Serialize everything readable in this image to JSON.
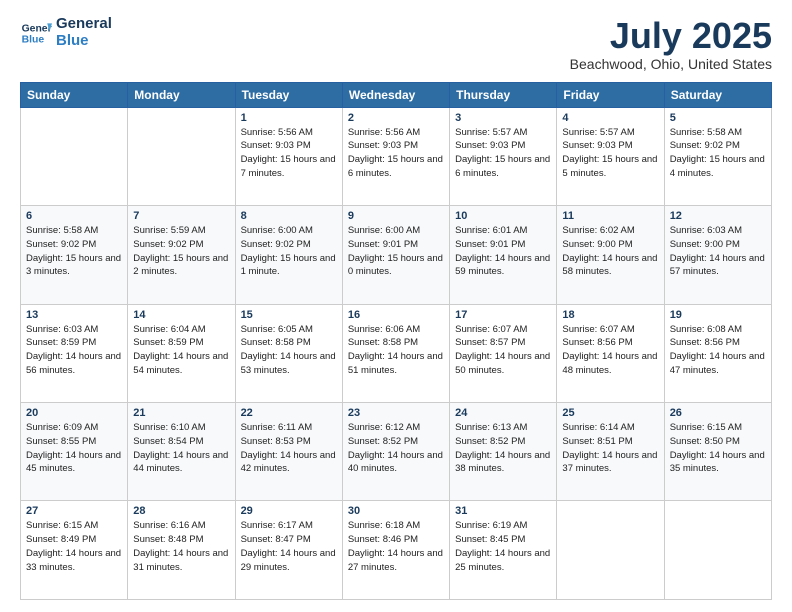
{
  "logo": {
    "line1": "General",
    "line2": "Blue"
  },
  "title": "July 2025",
  "subtitle": "Beachwood, Ohio, United States",
  "days_of_week": [
    "Sunday",
    "Monday",
    "Tuesday",
    "Wednesday",
    "Thursday",
    "Friday",
    "Saturday"
  ],
  "weeks": [
    [
      {
        "day": "",
        "info": ""
      },
      {
        "day": "",
        "info": ""
      },
      {
        "day": "1",
        "info": "Sunrise: 5:56 AM\nSunset: 9:03 PM\nDaylight: 15 hours and 7 minutes."
      },
      {
        "day": "2",
        "info": "Sunrise: 5:56 AM\nSunset: 9:03 PM\nDaylight: 15 hours and 6 minutes."
      },
      {
        "day": "3",
        "info": "Sunrise: 5:57 AM\nSunset: 9:03 PM\nDaylight: 15 hours and 6 minutes."
      },
      {
        "day": "4",
        "info": "Sunrise: 5:57 AM\nSunset: 9:03 PM\nDaylight: 15 hours and 5 minutes."
      },
      {
        "day": "5",
        "info": "Sunrise: 5:58 AM\nSunset: 9:02 PM\nDaylight: 15 hours and 4 minutes."
      }
    ],
    [
      {
        "day": "6",
        "info": "Sunrise: 5:58 AM\nSunset: 9:02 PM\nDaylight: 15 hours and 3 minutes."
      },
      {
        "day": "7",
        "info": "Sunrise: 5:59 AM\nSunset: 9:02 PM\nDaylight: 15 hours and 2 minutes."
      },
      {
        "day": "8",
        "info": "Sunrise: 6:00 AM\nSunset: 9:02 PM\nDaylight: 15 hours and 1 minute."
      },
      {
        "day": "9",
        "info": "Sunrise: 6:00 AM\nSunset: 9:01 PM\nDaylight: 15 hours and 0 minutes."
      },
      {
        "day": "10",
        "info": "Sunrise: 6:01 AM\nSunset: 9:01 PM\nDaylight: 14 hours and 59 minutes."
      },
      {
        "day": "11",
        "info": "Sunrise: 6:02 AM\nSunset: 9:00 PM\nDaylight: 14 hours and 58 minutes."
      },
      {
        "day": "12",
        "info": "Sunrise: 6:03 AM\nSunset: 9:00 PM\nDaylight: 14 hours and 57 minutes."
      }
    ],
    [
      {
        "day": "13",
        "info": "Sunrise: 6:03 AM\nSunset: 8:59 PM\nDaylight: 14 hours and 56 minutes."
      },
      {
        "day": "14",
        "info": "Sunrise: 6:04 AM\nSunset: 8:59 PM\nDaylight: 14 hours and 54 minutes."
      },
      {
        "day": "15",
        "info": "Sunrise: 6:05 AM\nSunset: 8:58 PM\nDaylight: 14 hours and 53 minutes."
      },
      {
        "day": "16",
        "info": "Sunrise: 6:06 AM\nSunset: 8:58 PM\nDaylight: 14 hours and 51 minutes."
      },
      {
        "day": "17",
        "info": "Sunrise: 6:07 AM\nSunset: 8:57 PM\nDaylight: 14 hours and 50 minutes."
      },
      {
        "day": "18",
        "info": "Sunrise: 6:07 AM\nSunset: 8:56 PM\nDaylight: 14 hours and 48 minutes."
      },
      {
        "day": "19",
        "info": "Sunrise: 6:08 AM\nSunset: 8:56 PM\nDaylight: 14 hours and 47 minutes."
      }
    ],
    [
      {
        "day": "20",
        "info": "Sunrise: 6:09 AM\nSunset: 8:55 PM\nDaylight: 14 hours and 45 minutes."
      },
      {
        "day": "21",
        "info": "Sunrise: 6:10 AM\nSunset: 8:54 PM\nDaylight: 14 hours and 44 minutes."
      },
      {
        "day": "22",
        "info": "Sunrise: 6:11 AM\nSunset: 8:53 PM\nDaylight: 14 hours and 42 minutes."
      },
      {
        "day": "23",
        "info": "Sunrise: 6:12 AM\nSunset: 8:52 PM\nDaylight: 14 hours and 40 minutes."
      },
      {
        "day": "24",
        "info": "Sunrise: 6:13 AM\nSunset: 8:52 PM\nDaylight: 14 hours and 38 minutes."
      },
      {
        "day": "25",
        "info": "Sunrise: 6:14 AM\nSunset: 8:51 PM\nDaylight: 14 hours and 37 minutes."
      },
      {
        "day": "26",
        "info": "Sunrise: 6:15 AM\nSunset: 8:50 PM\nDaylight: 14 hours and 35 minutes."
      }
    ],
    [
      {
        "day": "27",
        "info": "Sunrise: 6:15 AM\nSunset: 8:49 PM\nDaylight: 14 hours and 33 minutes."
      },
      {
        "day": "28",
        "info": "Sunrise: 6:16 AM\nSunset: 8:48 PM\nDaylight: 14 hours and 31 minutes."
      },
      {
        "day": "29",
        "info": "Sunrise: 6:17 AM\nSunset: 8:47 PM\nDaylight: 14 hours and 29 minutes."
      },
      {
        "day": "30",
        "info": "Sunrise: 6:18 AM\nSunset: 8:46 PM\nDaylight: 14 hours and 27 minutes."
      },
      {
        "day": "31",
        "info": "Sunrise: 6:19 AM\nSunset: 8:45 PM\nDaylight: 14 hours and 25 minutes."
      },
      {
        "day": "",
        "info": ""
      },
      {
        "day": "",
        "info": ""
      }
    ]
  ]
}
